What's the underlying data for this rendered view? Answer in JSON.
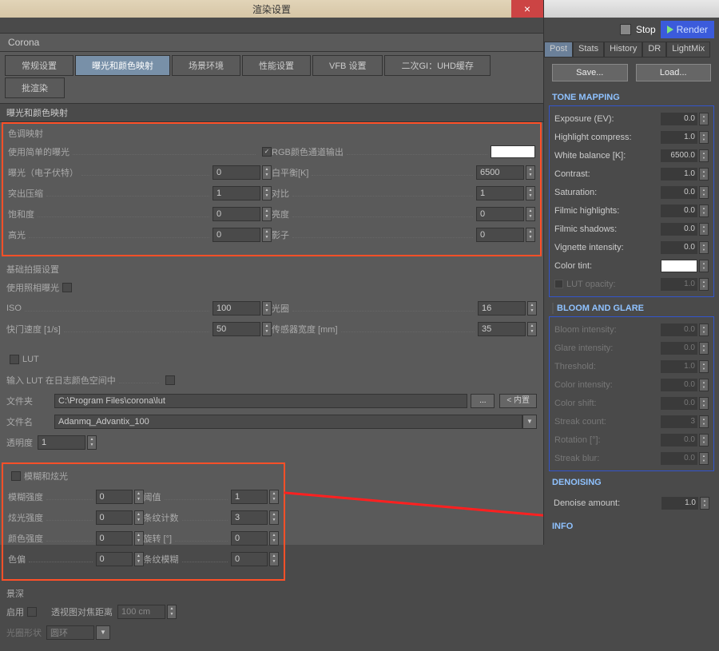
{
  "left": {
    "window_title": "渲染设置",
    "corona_label": "Corona",
    "tabs": {
      "general": "常规设置",
      "exposure": "曝光和颜色映射",
      "scene": "场景环境",
      "perf": "性能设置",
      "vfb": "VFB 设置",
      "gi": "二次GI：UHD缓存",
      "batch": "批渲染"
    },
    "section_exposure_title": "曝光和颜色映射",
    "tonemap_group": "色调映射",
    "use_simple_exposure": "使用简单的曝光",
    "rgb_output": "RGB颜色通道输出",
    "exposure_ev": "曝光（电子伏特）",
    "exposure_ev_val": "0",
    "white_balance": "白平衡[K]",
    "white_balance_val": "6500",
    "highlight_compress": "突出压缩",
    "highlight_compress_val": "1",
    "contrast": "对比",
    "contrast_val": "1",
    "saturation": "饱和度",
    "saturation_val": "0",
    "brightness": "亮度",
    "brightness_val": "0",
    "highlight": "高光",
    "highlight_val": "0",
    "shadow": "影子",
    "shadow_val": "0",
    "basic_shoot": "基础拍摄设置",
    "use_camera_exposure": "使用照相曝光",
    "iso": "ISO",
    "iso_val": "100",
    "aperture": "光圈",
    "aperture_val": "16",
    "shutter": "快门速度 [1/s]",
    "shutter_val": "50",
    "sensor": "传感器宽度 [mm]",
    "sensor_val": "35",
    "lut_section": "LUT",
    "lut_input_log": "输入 LUT 在日志颜色空间中",
    "lut_folder_label": "文件夹",
    "lut_folder": "C:\\Program Files\\corona\\lut",
    "lut_file_label": "文件名",
    "lut_file": "Adanmq_Advantix_100",
    "lut_opacity_label": "透明度",
    "lut_opacity_val": "1",
    "browse_btn": "...",
    "inner_btn": "< 内置",
    "blur_group": "模糊和炫光",
    "blur_intensity": "模糊强度",
    "blur_intensity_val": "0",
    "threshold": "阈值",
    "threshold_val": "1",
    "glare_intensity": "炫光强度",
    "glare_intensity_val": "0",
    "streak_count": "条纹计数",
    "streak_count_val": "3",
    "color_intensity": "颜色强度",
    "color_intensity_val": "0",
    "rotation": "旋转 [°]",
    "rotation_val": "0",
    "color_shift": "色偏",
    "color_shift_val": "0",
    "streak_blur": "条纹模糊",
    "streak_blur_val": "0",
    "dof_group": "景深",
    "enable_label": "启用",
    "perspective_focal": "透视图对焦距离",
    "perspective_focal_val": "100 cm",
    "aperture_shape": "光圈形状",
    "aperture_shape_val": "圆环"
  },
  "right": {
    "stop_label": "Stop",
    "render_label": "Render",
    "tabs": {
      "post": "Post",
      "stats": "Stats",
      "history": "History",
      "dr": "DR",
      "lightmix": "LightMix"
    },
    "save_btn": "Save...",
    "load_btn": "Load...",
    "tone_mapping_hdr": "TONE MAPPING",
    "tone": {
      "exposure_ev": "Exposure (EV):",
      "exposure_ev_val": "0.0",
      "highlight_compress": "Highlight compress:",
      "highlight_compress_val": "1.0",
      "white_balance": "White balance [K]:",
      "white_balance_val": "6500.0",
      "contrast": "Contrast:",
      "contrast_val": "1.0",
      "saturation": "Saturation:",
      "saturation_val": "0.0",
      "filmic_hl": "Filmic highlights:",
      "filmic_hl_val": "0.0",
      "filmic_sh": "Filmic shadows:",
      "filmic_sh_val": "0.0",
      "vignette": "Vignette intensity:",
      "vignette_val": "0.0",
      "color_tint": "Color tint:",
      "lut_opacity": "LUT opacity:",
      "lut_opacity_val": "1.0"
    },
    "bloom_hdr": "BLOOM AND GLARE",
    "bloom": {
      "bloom_intensity": "Bloom intensity:",
      "bloom_intensity_val": "0.0",
      "glare_intensity": "Glare intensity:",
      "glare_intensity_val": "0.0",
      "threshold": "Threshold:",
      "threshold_val": "1.0",
      "color_intensity": "Color intensity:",
      "color_intensity_val": "0.0",
      "color_shift": "Color shift:",
      "color_shift_val": "0.0",
      "streak_count": "Streak count:",
      "streak_count_val": "3",
      "rotation": "Rotation [°]:",
      "rotation_val": "0.0",
      "streak_blur": "Streak blur:",
      "streak_blur_val": "0.0"
    },
    "denoising_hdr": "DENOISING",
    "denoise_amount": "Denoise amount:",
    "denoise_amount_val": "1.0",
    "info_hdr": "INFO"
  }
}
